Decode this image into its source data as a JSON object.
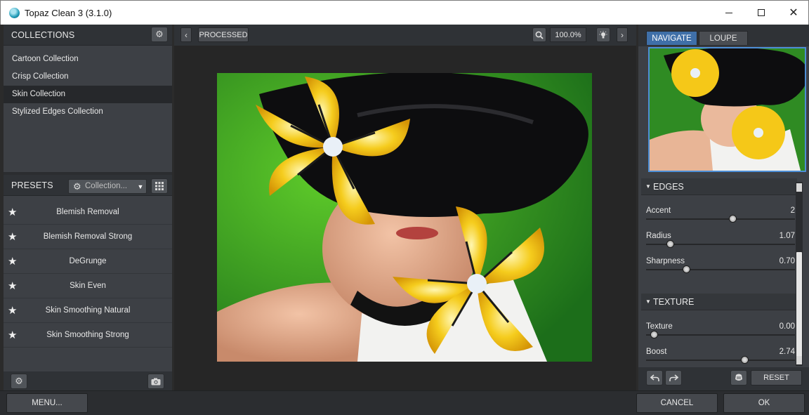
{
  "window": {
    "title": "Topaz Clean 3 (3.1.0)",
    "minimize_glyph": "–",
    "close_glyph": "✕"
  },
  "collections": {
    "header": "COLLECTIONS",
    "items": [
      {
        "label": "Cartoon Collection",
        "selected": false
      },
      {
        "label": "Crisp Collection",
        "selected": false
      },
      {
        "label": "Skin Collection",
        "selected": true
      },
      {
        "label": "Stylized Edges Collection",
        "selected": false
      }
    ]
  },
  "presets": {
    "header": "PRESETS",
    "filter_label": "Collection...",
    "items": [
      {
        "label": "Blemish Removal"
      },
      {
        "label": "Blemish Removal Strong"
      },
      {
        "label": "DeGrunge"
      },
      {
        "label": "Skin Even"
      },
      {
        "label": "Skin Smoothing Natural"
      },
      {
        "label": "Skin Smoothing Strong"
      }
    ]
  },
  "preview": {
    "view_mode": "PROCESSED",
    "zoom": "100.0%"
  },
  "navigator": {
    "tabs": [
      "NAVIGATE",
      "LOUPE"
    ],
    "active_tab": "NAVIGATE"
  },
  "edges": {
    "header": "EDGES",
    "sliders": [
      {
        "label": "Accent",
        "value": "2",
        "level": 0.58
      },
      {
        "label": "Radius",
        "value": "1.07",
        "level": 0.16
      },
      {
        "label": "Sharpness",
        "value": "0.70",
        "level": 0.27
      }
    ]
  },
  "texture": {
    "header": "TEXTURE",
    "sliders": [
      {
        "label": "Texture",
        "value": "0.00",
        "level": 0.05
      },
      {
        "label": "Boost",
        "value": "2.74",
        "level": 0.66
      }
    ]
  },
  "actions": {
    "reset": "RESET",
    "menu": "MENU...",
    "cancel": "CANCEL",
    "ok": "OK"
  },
  "colors": {
    "accent": "#3f6fa8",
    "panel": "#3d4045",
    "selected_row": "#26282b"
  }
}
